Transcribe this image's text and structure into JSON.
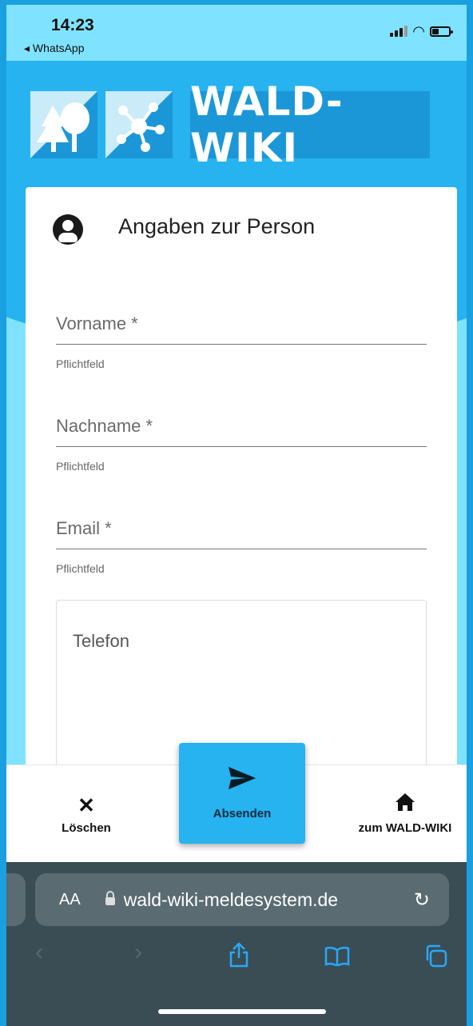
{
  "status_bar": {
    "time": "14:23",
    "back_app": "◂ WhatsApp"
  },
  "header": {
    "logo_title": "WALD-WIKI"
  },
  "card": {
    "title": "Angaben zur Person",
    "fields": [
      {
        "label": "Vorname *",
        "hint": "Pflichtfeld"
      },
      {
        "label": "Nachname *",
        "hint": "Pflichtfeld"
      },
      {
        "label": "Email *",
        "hint": "Pflichtfeld"
      }
    ],
    "textarea_label": "Telefon"
  },
  "actions": {
    "clear_label": "Löschen",
    "send_label": "Absenden",
    "home_label": "zum WALD-WIKI"
  },
  "browser": {
    "aa": "AA",
    "url": "wald-wiki-meldesystem.de"
  },
  "colors": {
    "brand_blue": "#27b2f0",
    "light_blue": "#7fe3ff",
    "logo_blue": "#1b97d8"
  }
}
